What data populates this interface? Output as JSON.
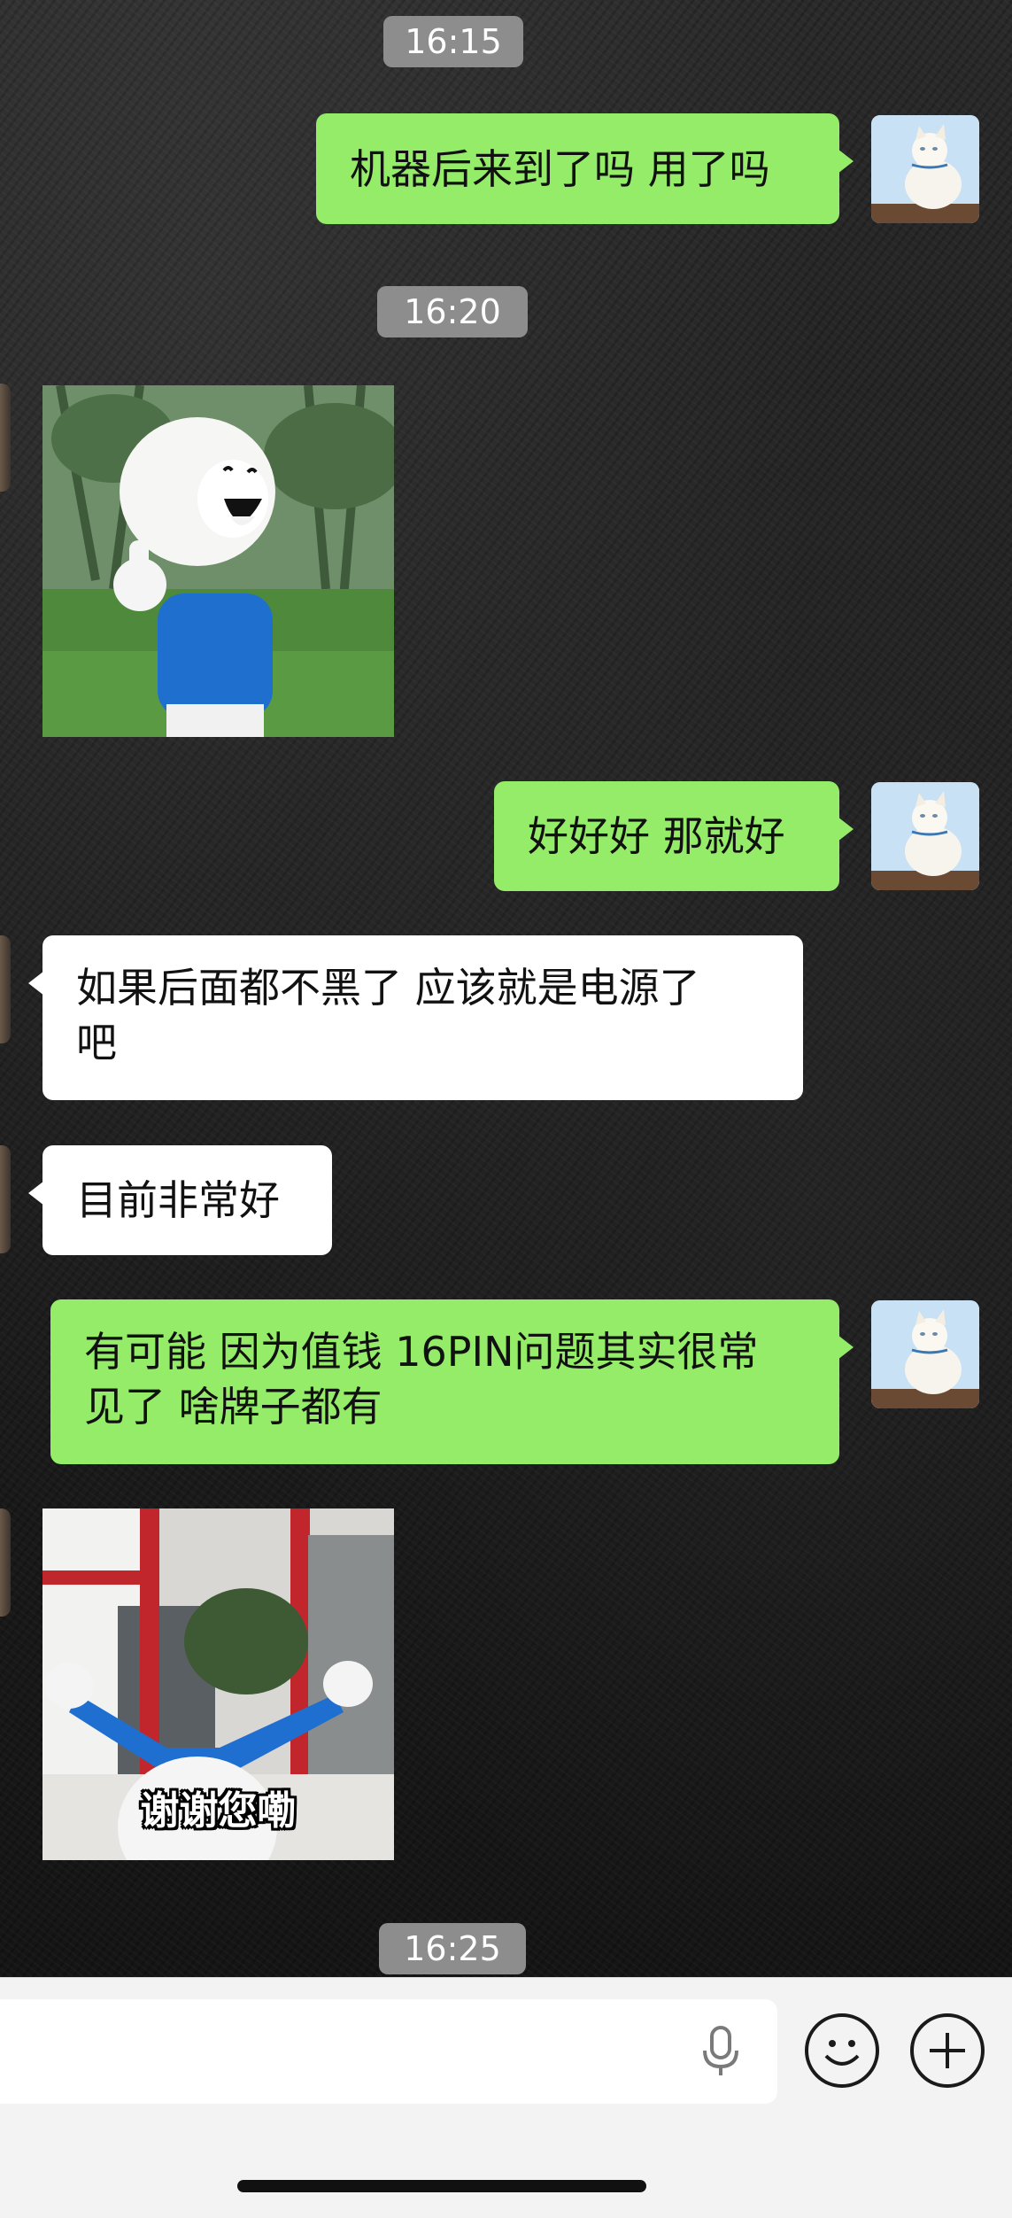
{
  "timestamps": {
    "t1": "16:15",
    "t2": "16:20",
    "t3": "16:25"
  },
  "messages": {
    "m1": "机器后来到了吗 用了吗",
    "m3": "好好好 那就好",
    "m4_line1": "如果后面都不黑了 应该就是电源了",
    "m4_line2": "吧",
    "m5": "目前非常好",
    "m6_line1": "有可能 因为值钱 16PIN问题其实很常",
    "m6_line2": "见了 啥牌子都有"
  },
  "stickers": {
    "s1": {
      "icon": "thumbs-up-mascot-sticker"
    },
    "s2": {
      "icon": "waving-mascot-sticker",
      "caption": "谢谢您嘞"
    }
  },
  "input_bar": {
    "value": "",
    "placeholder": "",
    "icons": {
      "voice": "microphone-icon",
      "emoji": "smiley-icon",
      "more": "plus-icon"
    }
  },
  "colors": {
    "outgoing_bubble": "#95ec69",
    "incoming_bubble": "#ffffff",
    "timestamp_bg": "#8d8d8d"
  }
}
